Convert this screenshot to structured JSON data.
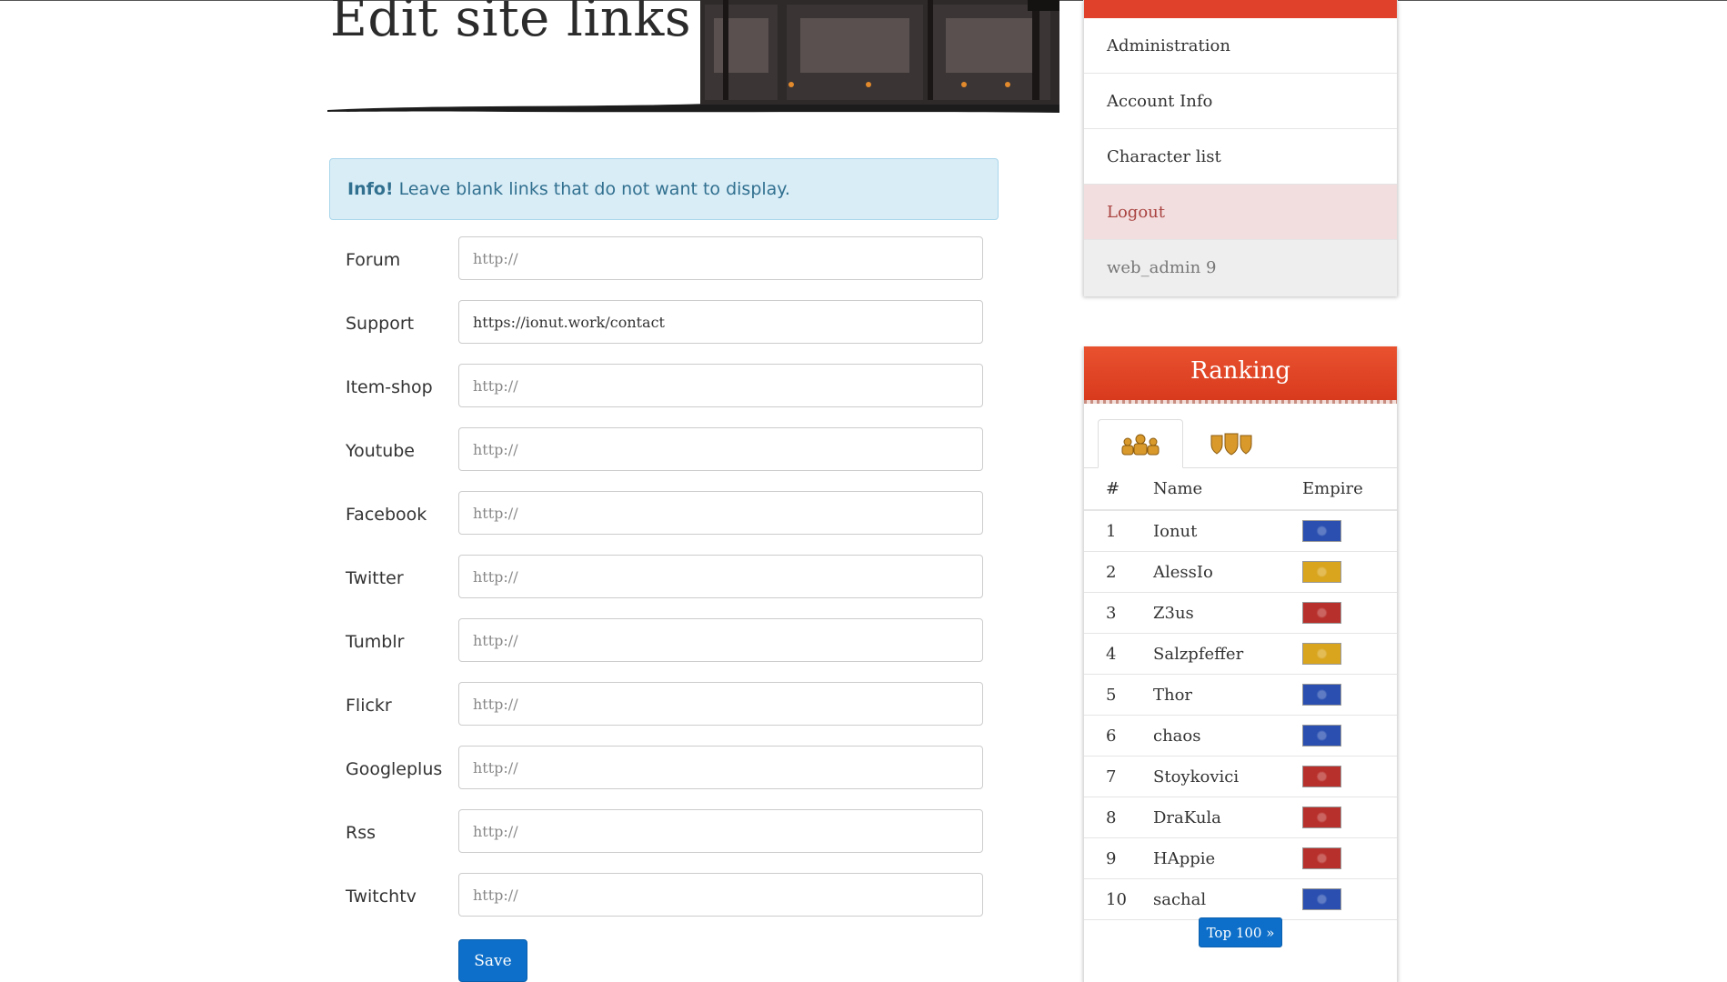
{
  "page": {
    "title": "Edit site links"
  },
  "alert": {
    "strong": "Info!",
    "text": "Leave blank links that do not want to display."
  },
  "form": {
    "placeholder": "http://",
    "fields": [
      {
        "label": "Forum",
        "value": ""
      },
      {
        "label": "Support",
        "value": "https://ionut.work/contact"
      },
      {
        "label": "Item-shop",
        "value": ""
      },
      {
        "label": "Youtube",
        "value": ""
      },
      {
        "label": "Facebook",
        "value": ""
      },
      {
        "label": "Twitter",
        "value": ""
      },
      {
        "label": "Tumblr",
        "value": ""
      },
      {
        "label": "Flickr",
        "value": ""
      },
      {
        "label": "Googleplus",
        "value": ""
      },
      {
        "label": "Rss",
        "value": ""
      },
      {
        "label": "Twitchtv",
        "value": ""
      }
    ],
    "save_label": "Save"
  },
  "user_menu": {
    "items": [
      {
        "label": "Administration"
      },
      {
        "label": "Account Info"
      },
      {
        "label": "Character list"
      },
      {
        "label": "Logout"
      }
    ],
    "username": "web_admin 9"
  },
  "ranking": {
    "title": "Ranking",
    "tabs": [
      {
        "icon": "players-icon"
      },
      {
        "icon": "guilds-shield-icon"
      }
    ],
    "columns": [
      "#",
      "Name",
      "Empire"
    ],
    "rows": [
      {
        "rank": "1",
        "name": "Ionut",
        "empire": "blue"
      },
      {
        "rank": "2",
        "name": "AlessIo",
        "empire": "yellow"
      },
      {
        "rank": "3",
        "name": "Z3us",
        "empire": "red"
      },
      {
        "rank": "4",
        "name": "Salzpfeffer",
        "empire": "yellow"
      },
      {
        "rank": "5",
        "name": "Thor",
        "empire": "blue"
      },
      {
        "rank": "6",
        "name": "chaos",
        "empire": "blue"
      },
      {
        "rank": "7",
        "name": "Stoykovici",
        "empire": "red"
      },
      {
        "rank": "8",
        "name": "DraKula",
        "empire": "red"
      },
      {
        "rank": "9",
        "name": "HAppie",
        "empire": "red"
      },
      {
        "rank": "10",
        "name": "sachal",
        "empire": "blue"
      }
    ],
    "top100_label": "Top 100 »"
  },
  "colors": {
    "accent_red": "#e0412b",
    "button_blue": "#0d6fc9",
    "info_bg": "#d9edf7",
    "info_text": "#31708f",
    "logout_bg": "#f2dede",
    "logout_text": "#a94442",
    "empire_blue": "#2a4fb0",
    "empire_yellow": "#d9a51e",
    "empire_red": "#b8302c"
  }
}
